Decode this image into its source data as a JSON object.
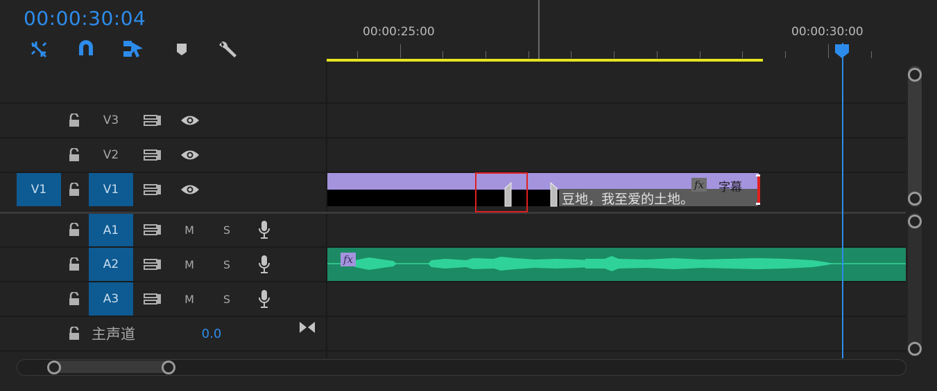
{
  "timecode": "00:00:30:04",
  "toolbar": {
    "tools": [
      "snap-linked-selection-icon",
      "magnet-snap-icon",
      "linked-selection-icon",
      "add-marker-icon",
      "wrench-settings-icon"
    ]
  },
  "ruler": {
    "labels": [
      "00:00:25:00",
      "00:00:30:00"
    ]
  },
  "tracks": {
    "video": [
      {
        "source": "",
        "name": "V3"
      },
      {
        "source": "",
        "name": "V2"
      },
      {
        "source": "V1",
        "name": "V1"
      }
    ],
    "audio": [
      {
        "name": "A1",
        "mute": "M",
        "solo": "S"
      },
      {
        "name": "A2",
        "mute": "M",
        "solo": "S"
      },
      {
        "name": "A3",
        "mute": "M",
        "solo": "S"
      }
    ],
    "master": {
      "label": "主声道",
      "value": "0.0"
    }
  },
  "clips": {
    "video": {
      "title": "字幕",
      "caption": "豆地，我至爱的土地。",
      "fx": "fx"
    },
    "audio": {
      "fx": "fx"
    }
  },
  "colors": {
    "accent": "#2d8ceb",
    "video_clip": "#a493dd",
    "audio_clip": "#1c8a64",
    "waveform": "#2fd39a",
    "work_area": "#e5e51f",
    "highlight_box": "#e02020"
  }
}
